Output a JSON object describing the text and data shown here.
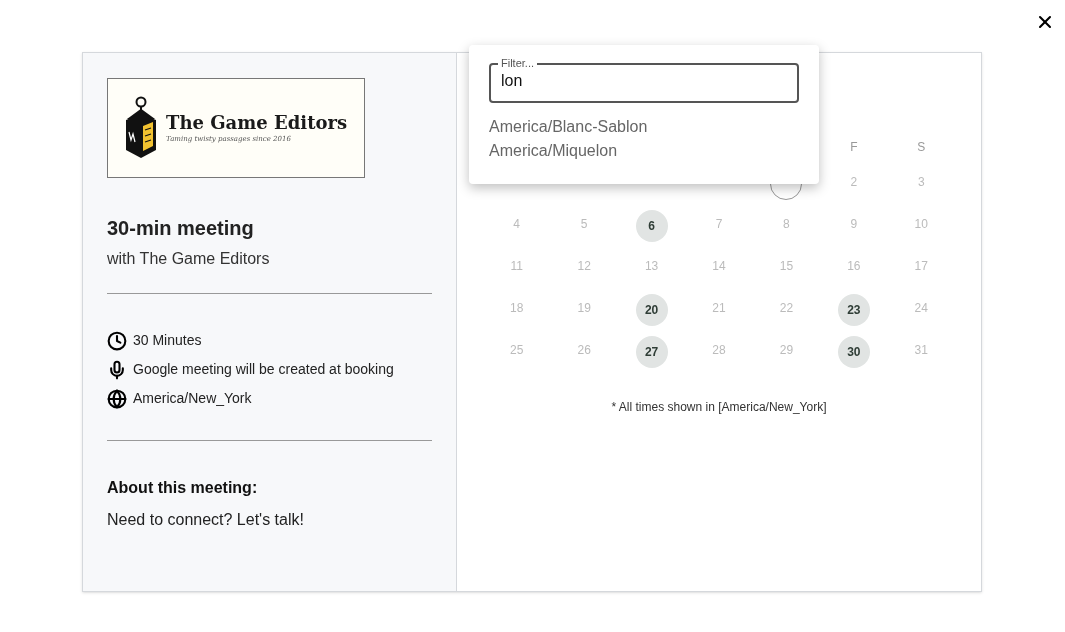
{
  "logo": {
    "name": "The Game Editors",
    "tagline": "Taming twisty passages since 2016"
  },
  "meeting": {
    "title": "30-min meeting",
    "host": "with The Game Editors"
  },
  "details": [
    {
      "kind": "duration",
      "text": "30 Minutes"
    },
    {
      "kind": "conference",
      "text": "Google meeting will be created at booking"
    },
    {
      "kind": "timezone",
      "text": "America/New_York"
    }
  ],
  "about": {
    "heading": "About this meeting:",
    "text": "Need to connect? Let's talk!"
  },
  "calendar": {
    "weekday_headers": [
      "F",
      "S"
    ],
    "weeks": [
      [
        {
          "available": false,
          "today": true
        },
        {
          "label": "2",
          "available": false,
          "today": false
        },
        {
          "label": "3",
          "available": false,
          "today": false
        }
      ],
      [
        {
          "label": "4",
          "available": false,
          "today": false
        },
        {
          "label": "5",
          "available": false,
          "today": false
        },
        {
          "label": "6",
          "available": true,
          "today": false
        },
        {
          "label": "7",
          "available": false,
          "today": false
        },
        {
          "label": "8",
          "available": false,
          "today": false
        },
        {
          "label": "9",
          "available": false,
          "today": false
        },
        {
          "label": "10",
          "available": false,
          "today": false
        }
      ],
      [
        {
          "label": "11",
          "available": false,
          "today": false
        },
        {
          "label": "12",
          "available": false,
          "today": false
        },
        {
          "label": "13",
          "available": false,
          "today": false
        },
        {
          "label": "14",
          "available": false,
          "today": false
        },
        {
          "label": "15",
          "available": false,
          "today": false
        },
        {
          "label": "16",
          "available": false,
          "today": false
        },
        {
          "label": "17",
          "available": false,
          "today": false
        }
      ],
      [
        {
          "label": "18",
          "available": false,
          "today": false
        },
        {
          "label": "19",
          "available": false,
          "today": false
        },
        {
          "label": "20",
          "available": true,
          "today": false
        },
        {
          "label": "21",
          "available": false,
          "today": false
        },
        {
          "label": "22",
          "available": false,
          "today": false
        },
        {
          "label": "23",
          "available": true,
          "today": false
        },
        {
          "label": "24",
          "available": false,
          "today": false
        }
      ],
      [
        {
          "label": "25",
          "available": false,
          "today": false
        },
        {
          "label": "26",
          "available": false,
          "today": false
        },
        {
          "label": "27",
          "available": true,
          "today": false
        },
        {
          "label": "28",
          "available": false,
          "today": false
        },
        {
          "label": "29",
          "available": false,
          "today": false
        },
        {
          "label": "30",
          "available": true,
          "today": false
        },
        {
          "label": "31",
          "available": false,
          "today": false
        }
      ]
    ],
    "timezone_note": "* All times shown in [America/New_York]"
  },
  "timezone_popover": {
    "label": "Filter...",
    "value": "lon",
    "options": [
      "America/Blanc-Sablon",
      "America/Miquelon"
    ]
  }
}
